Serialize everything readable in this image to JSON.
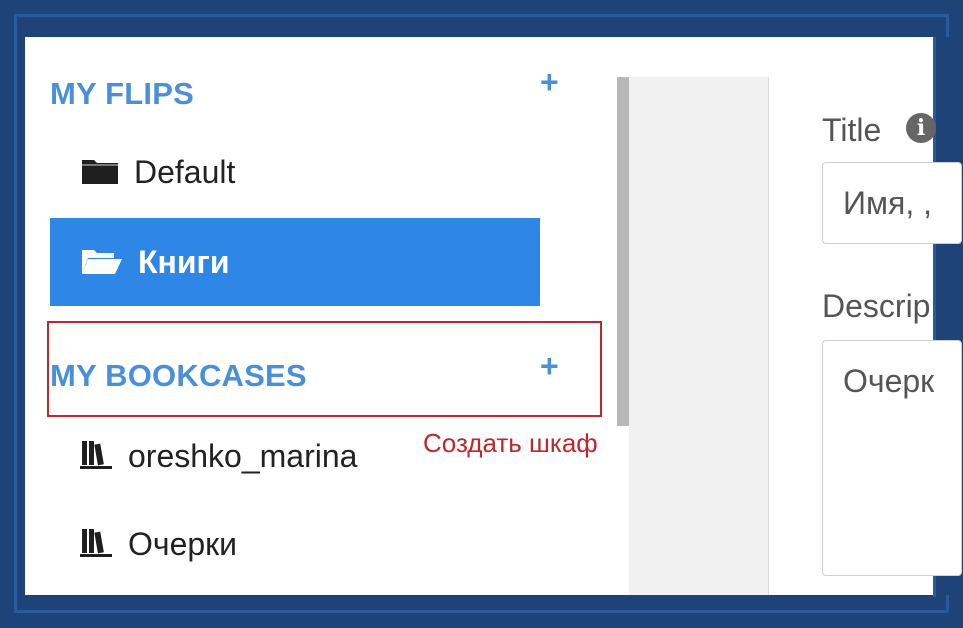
{
  "sidebar": {
    "flips_header": "MY FLIPS",
    "flips_add_icon": "plus-icon",
    "flips": [
      {
        "label": "Default",
        "icon": "folder-closed-icon",
        "active": false
      },
      {
        "label": "Книги",
        "icon": "folder-open-icon",
        "active": true
      }
    ],
    "bookcases_header": "MY BOOKCASES",
    "bookcases_add_icon": "plus-icon",
    "bookcases": [
      {
        "label": "oreshko_marina",
        "icon": "bookcase-icon"
      },
      {
        "label": "Очерки",
        "icon": "bookcase-icon"
      }
    ]
  },
  "annotation": {
    "text": "Создать шкаф",
    "color": "#c0272d"
  },
  "form": {
    "title_label": "Title",
    "title_value": "Имя, ,",
    "description_label": "Descrip",
    "description_value": "Очерк"
  },
  "colors": {
    "accent": "#4a90d9",
    "active_bg": "#2e86e6",
    "frame": "#1e4379"
  }
}
